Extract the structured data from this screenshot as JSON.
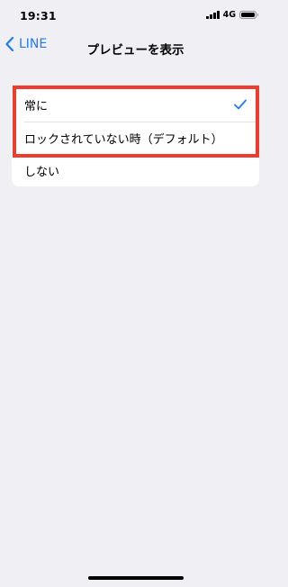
{
  "status_bar": {
    "time": "19:31",
    "network": "4G",
    "battery_level": 1.0
  },
  "nav": {
    "back_label": "LINE",
    "title": "プレビューを表示"
  },
  "options": [
    {
      "label": "常に",
      "selected": true
    },
    {
      "label": "ロックされていない時（デフォルト）",
      "selected": false
    },
    {
      "label": "しない",
      "selected": false
    }
  ],
  "colors": {
    "background": "#efeff4",
    "accent": "#1f7cf2",
    "highlight": "#f03c2c"
  },
  "icons": {
    "back": "chevron-left-icon",
    "check": "checkmark-icon",
    "signal": "cellular-signal-icon",
    "battery": "battery-icon"
  }
}
